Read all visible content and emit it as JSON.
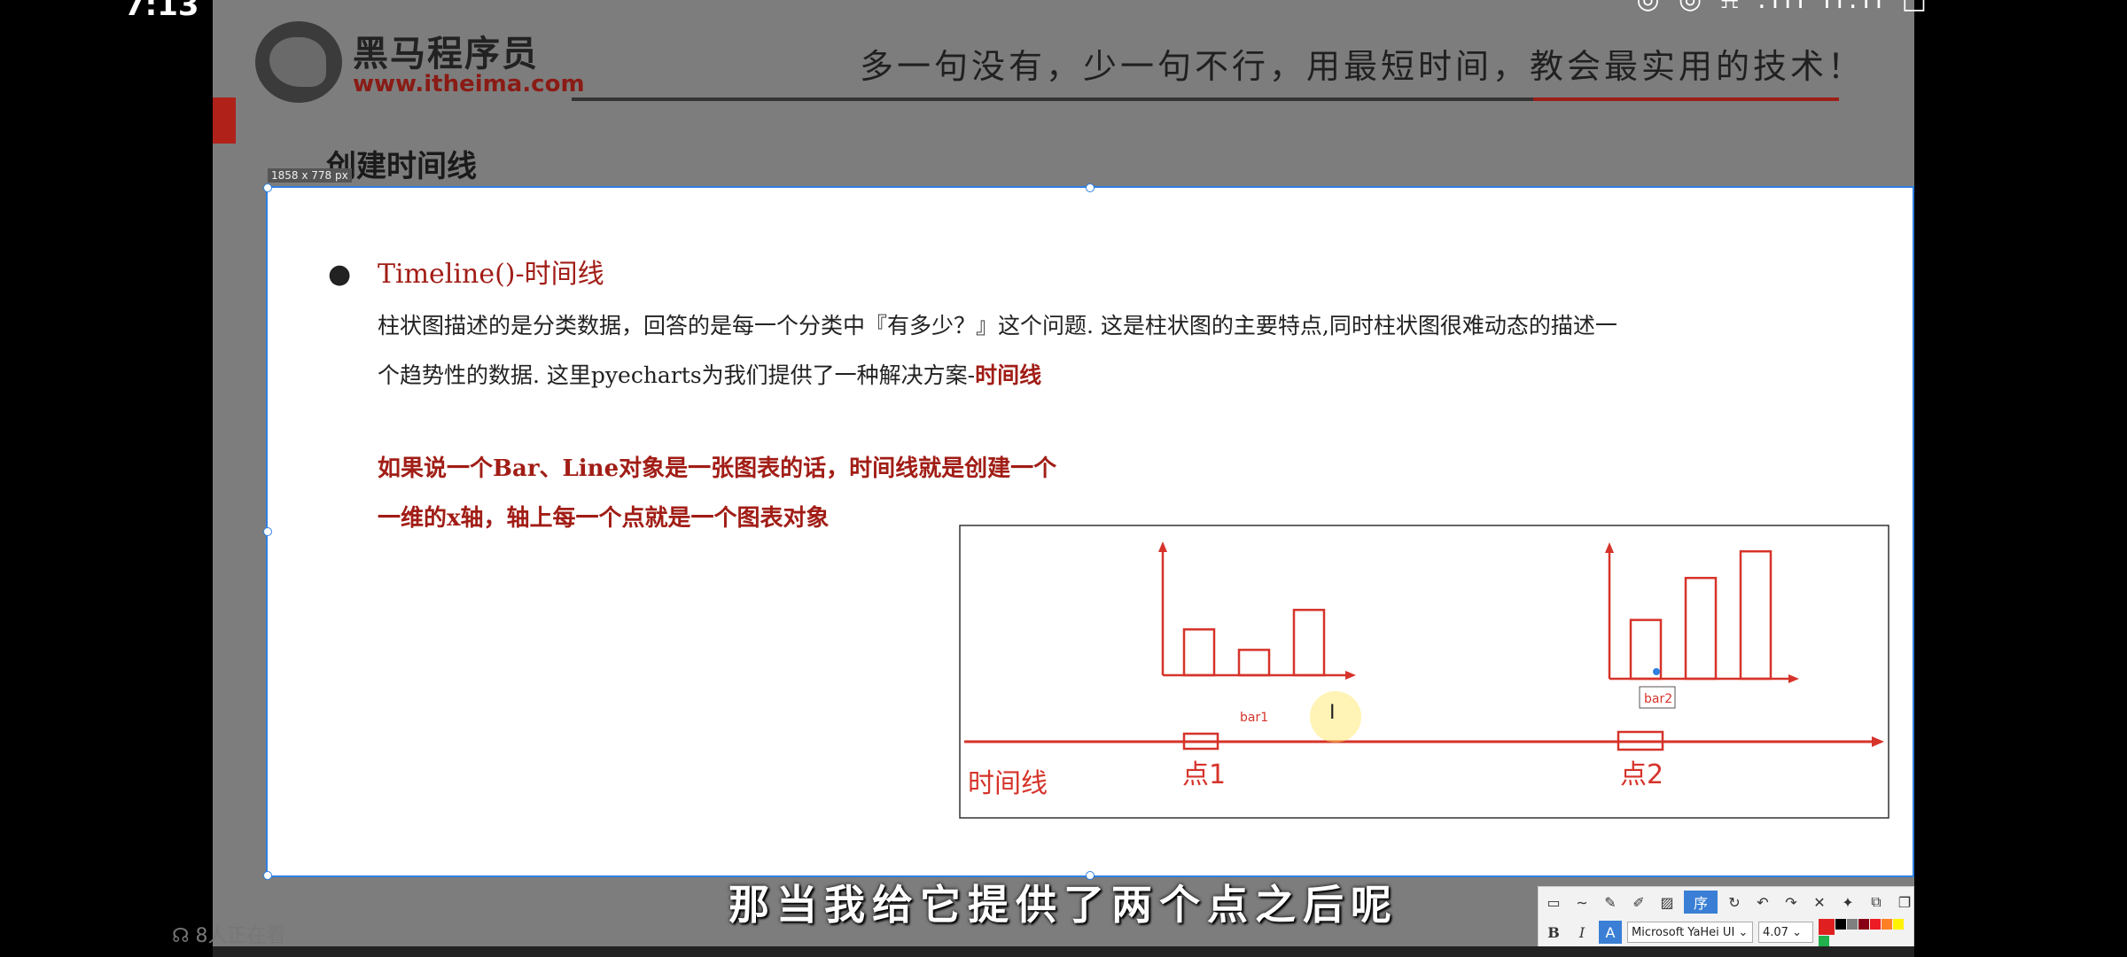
{
  "status_bar": {
    "time": "7:13",
    "icons": "◎ ◎ ⍾ .ııl ıl.ıl □"
  },
  "header": {
    "logo_cn": "黑马程序员",
    "logo_url": "www.itheima.com",
    "slogan": "多一句没有，少一句不行，用最短时间，教会最实用的技术！",
    "title": "创建时间线"
  },
  "selection": {
    "size_label": "1858 x 778  px"
  },
  "content": {
    "heading": "Timeline()-时间线",
    "para_line1": "柱状图描述的是分类数据，回答的是每一个分类中『有多少？』这个问题. 这是柱状图的主要特点,同时柱状图很难动态的描述一",
    "para_line2_prefix": "个趋势性的数据. 这里pyecharts为我们提供了一种解决方案-",
    "para_line2_highlight": "时间线",
    "note_line1": "如果说一个Bar、Line对象是一张图表的话，时间线就是创建一个",
    "note_line2": "一维的x轴，轴上每一个点就是一个图表对象"
  },
  "diagram": {
    "bar1_label": "bar1",
    "bar2_label": "bar2",
    "point1_label": "点1",
    "point2_label": "点2",
    "timeline_label": "时间线",
    "bar1_values": [
      0.47,
      0.26,
      0.67
    ],
    "bar2_values": [
      0.42,
      0.72,
      0.91
    ],
    "accent_color": "#d6332a"
  },
  "toolbar": {
    "font_name": "Microsoft YaHei UI",
    "font_size": "4.07",
    "bold": "B",
    "italic": "I",
    "text": "A"
  },
  "subtitle": "那当我给它提供了两个点之后呢",
  "viewers": "8人正在看"
}
